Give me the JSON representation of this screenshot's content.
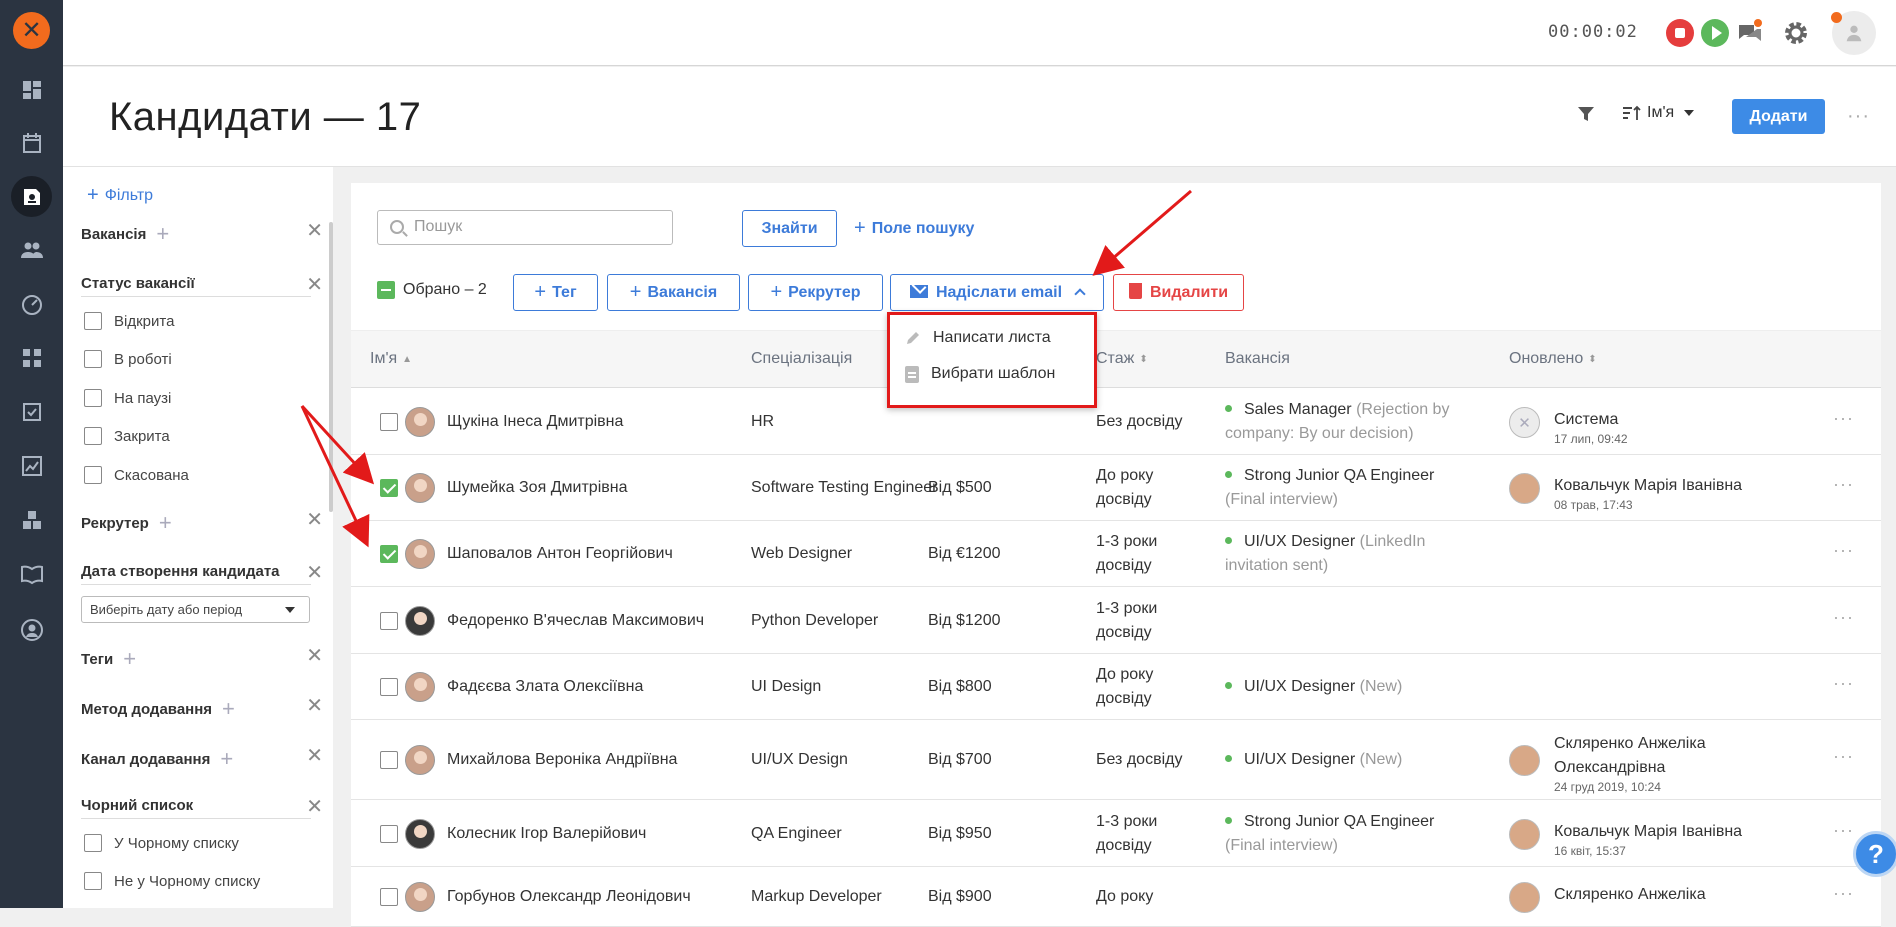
{
  "rail": {
    "icons": [
      "logo-icon",
      "dashboard-icon",
      "calendar-icon",
      "candidates-icon",
      "users-icon",
      "speedometer-icon",
      "hierarchy-icon",
      "tasks-icon",
      "analytics-icon",
      "integrations-icon",
      "book-icon",
      "profile-icon"
    ]
  },
  "topbar": {
    "timer": "00:00:02"
  },
  "header": {
    "title": "Кандидати — 17",
    "sort_label": "Ім'я",
    "add_label": "Додати",
    "more": "···"
  },
  "sidebar": {
    "filter_label": "Фільтр",
    "vacancy": "Вакансія",
    "vacancy_status": "Статус вакансії",
    "statuses": [
      "Відкрита",
      "В роботі",
      "На паузі",
      "Закрита",
      "Скасована"
    ],
    "recruiter": "Рекрутер",
    "created_date": "Дата створення кандидата",
    "date_placeholder": "Виберіть дату або період",
    "tags": "Теги",
    "add_method": "Метод додавання",
    "add_channel": "Канал додавання",
    "blacklist": "Чорний список",
    "blacklist_opts": [
      "У Чорному списку",
      "Не у Чорному списку"
    ]
  },
  "toolbar": {
    "search_placeholder": "Пошук",
    "find": "Знайти",
    "search_field": "Поле пошуку",
    "selected": "Обрано – 2",
    "tag": "Тег",
    "vacancy": "Вакансія",
    "recruiter": "Рекрутер",
    "send_email": "Надіслати email",
    "delete": "Видалити"
  },
  "email_menu": {
    "write": "Написати листа",
    "template": "Вибрати шаблон"
  },
  "table": {
    "headers": {
      "name": "Ім'я",
      "spec": "Спеціалізація",
      "exp": "Стаж",
      "vacancy": "Вакансія",
      "updated": "Оновлено"
    },
    "rows": [
      {
        "checked": false,
        "name": "Щукіна Інеса Дмитрівна",
        "spec": "HR",
        "salary": "",
        "exp": "Без досвіду",
        "vac": "Sales Manager",
        "vac_status": "(Rejection by company: By our decision)",
        "upd_name": "Система",
        "upd_time": "17 лип, 09:42"
      },
      {
        "checked": true,
        "name": "Шумейка Зоя Дмитрівна",
        "spec": "Software Testing Engineer",
        "salary": "Від $500",
        "exp": "До року досвіду",
        "vac": "Strong Junior QA Engineer",
        "vac_status": "(Final interview)",
        "upd_name": "Ковальчук Марія Іванівна",
        "upd_time": "08 трав, 17:43"
      },
      {
        "checked": true,
        "name": "Шаповалов Антон Георгійович",
        "spec": "Web Designer",
        "salary": "Від €1200",
        "exp": "1-3 роки досвіду",
        "vac": "UI/UX Designer",
        "vac_status": "(LinkedIn invitation sent)",
        "upd_name": "",
        "upd_time": ""
      },
      {
        "checked": false,
        "name": "Федоренко В'ячеслав Максимович",
        "spec": "Python Developer",
        "salary": "Від $1200",
        "exp": "1-3 роки досвіду",
        "vac": "",
        "vac_status": "",
        "upd_name": "",
        "upd_time": ""
      },
      {
        "checked": false,
        "name": "Фадєєва Злата Олексіївна",
        "spec": "UI Design",
        "salary": "Від $800",
        "exp": "До року досвіду",
        "vac": "UI/UX Designer",
        "vac_status": "(New)",
        "upd_name": "",
        "upd_time": ""
      },
      {
        "checked": false,
        "name": "Михайлова Вероніка Андріївна",
        "spec": "UI/UX Design",
        "salary": "Від $700",
        "exp": "Без досвіду",
        "vac": "UI/UX Designer",
        "vac_status": "(New)",
        "upd_name": "Скляренко Анжеліка Олександрівна",
        "upd_time": "24 груд 2019, 10:24"
      },
      {
        "checked": false,
        "name": "Колесник Ігор Валерійович",
        "spec": "QA Engineer",
        "salary": "Від $950",
        "exp": "1-3 роки досвіду",
        "vac": "Strong Junior QA Engineer",
        "vac_status": "(Final interview)",
        "upd_name": "Ковальчук Марія Іванівна",
        "upd_time": "16 квіт, 15:37"
      },
      {
        "checked": false,
        "name": "Горбунов Олександр Леонідович",
        "spec": "Markup Developer",
        "salary": "Від $900",
        "exp": "До року",
        "vac": "",
        "vac_status": "",
        "upd_name": "Скляренко Анжеліка",
        "upd_time": ""
      }
    ]
  },
  "colors": {
    "accent": "#3d8be6",
    "danger": "#e54545",
    "success": "#5cb85c",
    "rail": "#2b3441",
    "brand": "#f26b1d"
  }
}
